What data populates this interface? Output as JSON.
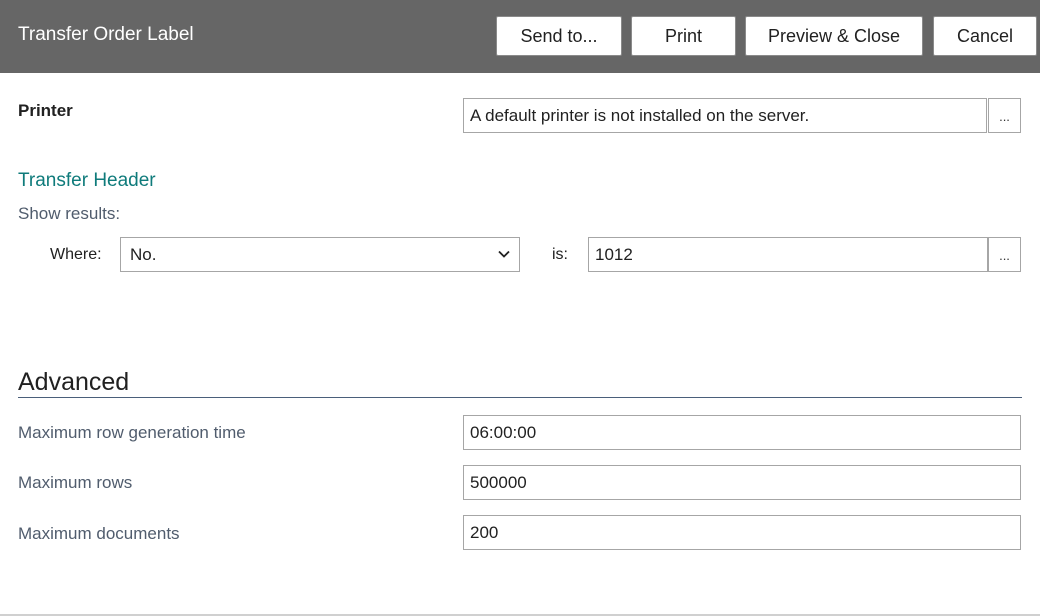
{
  "header": {
    "title": "Transfer Order Label",
    "buttons": {
      "send_to": "Send to...",
      "print": "Print",
      "preview_close": "Preview & Close",
      "cancel": "Cancel"
    }
  },
  "printer": {
    "label": "Printer",
    "value": "A default printer is not installed on the server.",
    "lookup_label": "..."
  },
  "filter": {
    "section_title": "Transfer Header",
    "show_results_label": "Show results:",
    "where_label": "Where:",
    "where_field": "No.",
    "is_label": "is:",
    "is_value": "1012",
    "lookup_label": "..."
  },
  "advanced": {
    "title": "Advanced",
    "fields": [
      {
        "label": "Maximum row generation time",
        "value": "06:00:00"
      },
      {
        "label": "Maximum rows",
        "value": "500000"
      },
      {
        "label": "Maximum documents",
        "value": "200"
      }
    ]
  },
  "colors": {
    "header_bg": "#666666",
    "link": "#0f7b7b",
    "label": "#505c6d"
  }
}
